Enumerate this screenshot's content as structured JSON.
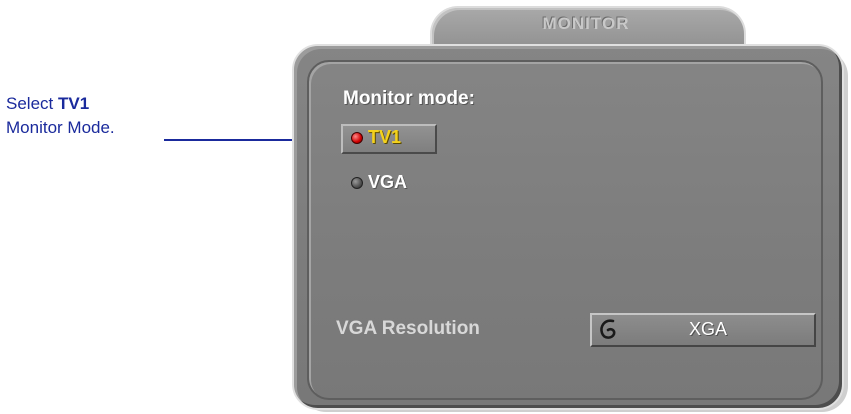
{
  "annotation": {
    "line1_prefix": "Select",
    "line1_bold": "TV1",
    "line2": "Monitor Mode."
  },
  "panel": {
    "tab_title": "MONITOR",
    "mode_label": "Monitor mode:",
    "options": [
      {
        "label": "TV1",
        "selected": true,
        "dot_color": "#d10000",
        "text_color": "#f4d21c"
      },
      {
        "label": "VGA",
        "selected": false,
        "dot_color": "#505050",
        "text_color": "#ffffff"
      }
    ],
    "resolution": {
      "label": "VGA Resolution",
      "value": "XGA",
      "icon": "cycle-arrow-icon"
    }
  },
  "colors": {
    "panel_bg": "#7f7f7f",
    "annotation_text": "#1a2a9c",
    "arrow": "#1a2a9c"
  }
}
